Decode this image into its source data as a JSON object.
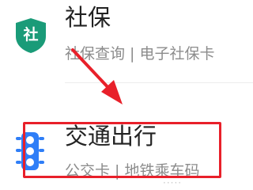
{
  "services": {
    "shebao": {
      "icon": "shield-icon",
      "icon_label": "社",
      "icon_color": "#1a9b78",
      "title": "社保",
      "subtitle": "社保查询 | 电子社保卡"
    },
    "jiaotong": {
      "icon": "traffic-light-icon",
      "icon_color": "#2f7ef7",
      "title": "交通出行",
      "subtitle": "公交卡 | 地铁乘车码"
    }
  },
  "annotation": {
    "arrow_color": "#e8202a",
    "box_color": "#e8202a"
  }
}
